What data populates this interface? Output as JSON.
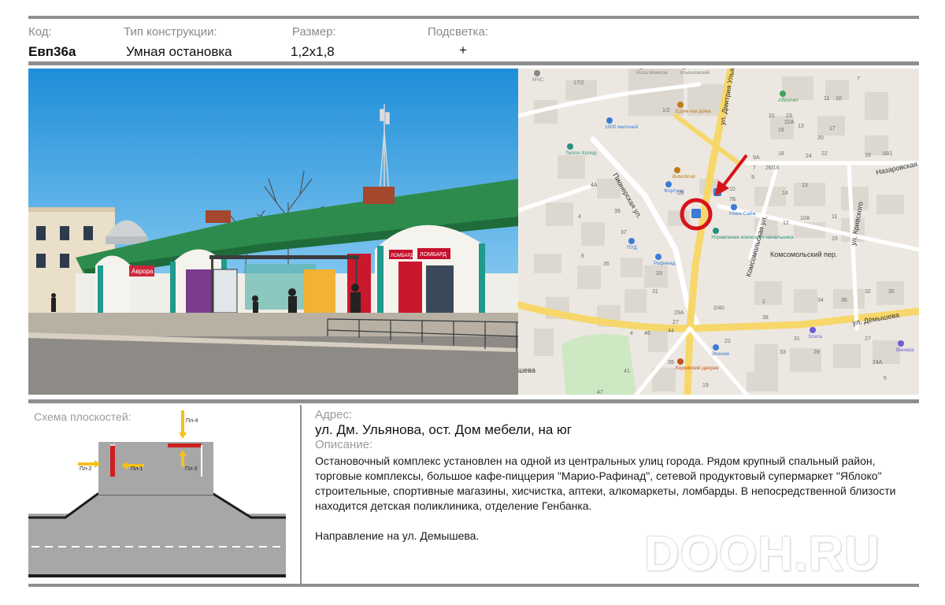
{
  "header": {
    "code_label": "Код:",
    "code_value": "Евп36а",
    "type_label": "Тип конструкции:",
    "type_value": "Умная остановка",
    "size_label": "Размер:",
    "size_value": "1,2x1,8",
    "light_label": "Подсветка:",
    "light_value": "+"
  },
  "photo": {
    "sign_pawnshop_1": "ЛОМБАРД",
    "sign_pawnshop_2": "ЛОМБАРД",
    "sign_shop": "Аврора"
  },
  "map": {
    "streets": {
      "pionerskaya": "Пионерская ул.",
      "dmitriya_ulyanova": "ул. Дмитрия Ульянова",
      "komsomolskaya": "Комсомольская ул.",
      "komsomolsky_per": "Комсомольский пер.",
      "demysheva": "ул. Дёмышева",
      "krivskogo": "ул. Кривского",
      "nazarovskaya": "Назаровская",
      "demysheva_short": "шева"
    },
    "pois": [
      "Роза Мимоза",
      "Ульяновский",
      "Едим как дома",
      "1000 мелочей",
      "Тепло-Холод",
      "Buterbrod",
      "Абсолют",
      "Фортуна",
      "Нева-Сайж",
      "Управление воинского начальника",
      "ПУД",
      "Рафинад",
      "Злата",
      "Эконом",
      "Корейский дворик",
      "Венера",
      "МЧС"
    ],
    "house_numbers": [
      "1/2",
      "1Б",
      "39",
      "37",
      "35",
      "33",
      "31",
      "29A",
      "27",
      "44",
      "46",
      "4",
      "6",
      "41",
      "47",
      "39",
      "19",
      "22",
      "2/40",
      "38",
      "2",
      "10",
      "7Б",
      "10A",
      "12",
      "14",
      "13",
      "15",
      "11",
      "34",
      "36",
      "32",
      "30",
      "27",
      "29",
      "31",
      "33",
      "24A",
      "6",
      "7",
      "9",
      "9A",
      "26/16",
      "18",
      "24",
      "22",
      "20",
      "17",
      "15",
      "13",
      "11",
      "10",
      "7",
      "22A",
      "23",
      "21",
      "19",
      "16/1",
      "17/2",
      "4A",
      "4",
      "3"
    ],
    "colors": {
      "accent": "#d6131b",
      "road": "#f7d76a",
      "bg": "#ece8e1"
    }
  },
  "schema": {
    "title": "Схема плоскостей:",
    "planes": [
      "Пл-1",
      "Пл-2",
      "Пл-3",
      "Пл-4"
    ]
  },
  "info": {
    "address_label": "Адрес:",
    "address_value": "ул. Дм. Ульянова, ост. Дом мебели, на юг",
    "description_label": "Описание:",
    "description_value": "Остановочный комплекс установлен на одной из центральных улиц города. Рядом крупный спальный район, торговые комплексы, большое кафе-пиццерия \"Марио-Рафинад\", сетевой продуктовый супермаркет \"Яблоко\" строительные, спортивные магазины, хисчистка, аптеки, алкомаркеты, ломбарды. В непосредственной близости находится детская поликлиника, отделение Генбанка.",
    "direction": "Направление на ул. Демышева."
  },
  "watermark": "DOOH.RU"
}
